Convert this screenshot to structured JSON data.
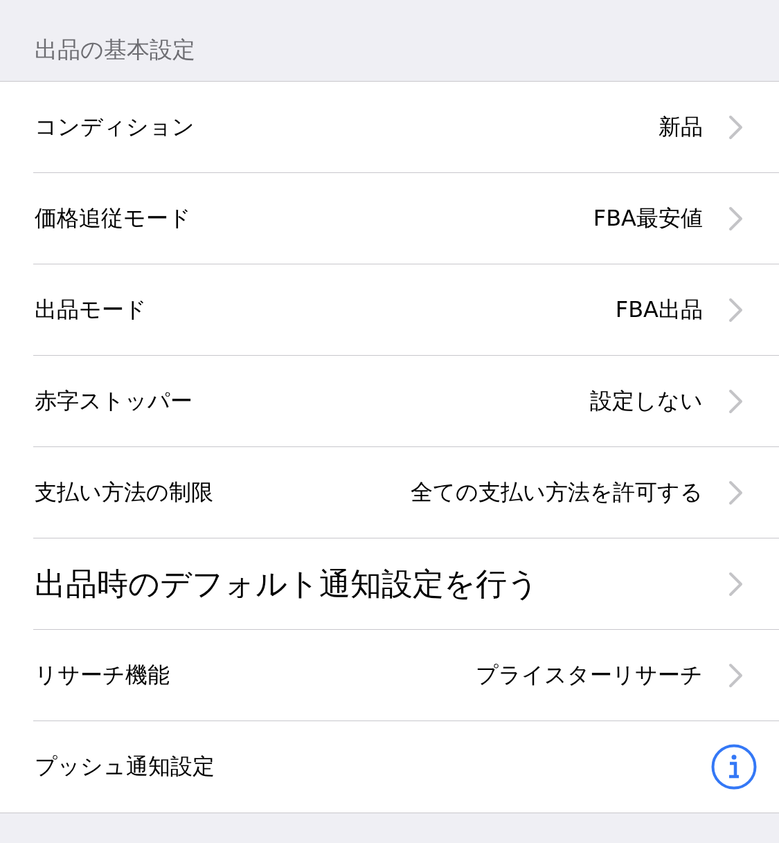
{
  "section_header": "出品の基本設定",
  "rows": [
    {
      "label": "コンディション",
      "value": "新品",
      "kind": "chevron",
      "large": false
    },
    {
      "label": "価格追従モード",
      "value": "FBA最安値",
      "kind": "chevron",
      "large": false
    },
    {
      "label": "出品モード",
      "value": "FBA出品",
      "kind": "chevron",
      "large": false
    },
    {
      "label": "赤字ストッパー",
      "value": "設定しない",
      "kind": "chevron",
      "large": false
    },
    {
      "label": "支払い方法の制限",
      "value": "全ての支払い方法を許可する",
      "kind": "chevron",
      "large": false
    },
    {
      "label": "出品時のデフォルト通知設定を行う",
      "kind": "chevron",
      "large": true
    },
    {
      "label": "リサーチ機能",
      "value": "プライスターリサーチ",
      "kind": "chevron",
      "large": false
    },
    {
      "label": "プッシュ通知設定",
      "kind": "info",
      "large": false
    }
  ]
}
